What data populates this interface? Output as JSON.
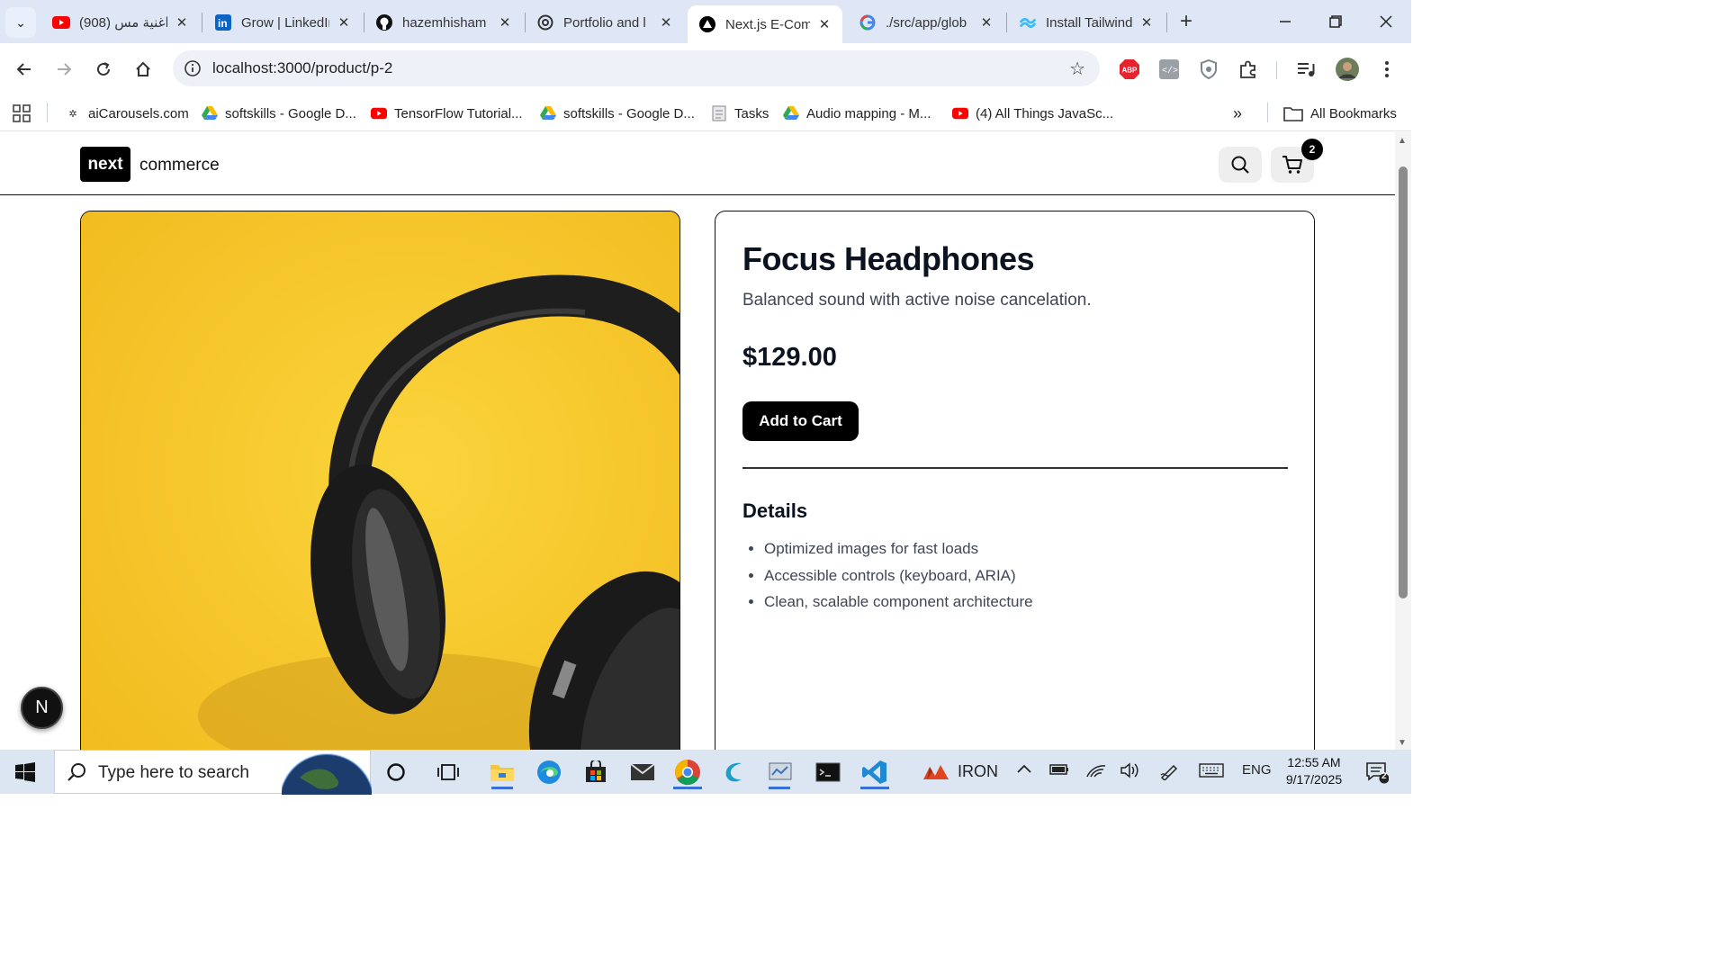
{
  "browser": {
    "tabs": [
      {
        "title": "(908) اغنية مس",
        "icon": "youtube-icon",
        "color": "#ff0000"
      },
      {
        "title": "Grow | LinkedIn",
        "icon": "linkedin-icon",
        "color": "#0a66c2"
      },
      {
        "title": "hazemhisham",
        "icon": "github-icon",
        "color": "#111111"
      },
      {
        "title": "Portfolio and l",
        "icon": "openai-icon",
        "color": "#333333"
      },
      {
        "title": "Next.js E-Com",
        "icon": "nextjs-icon",
        "color": "#000000",
        "active": true
      },
      {
        "title": "./src/app/glob",
        "icon": "google-icon",
        "color": "#4285f4"
      },
      {
        "title": "Install Tailwind",
        "icon": "tailwind-icon",
        "color": "#38bdf8"
      }
    ],
    "url": "localhost:3000/product/p-2",
    "bookmarks": [
      {
        "label": "aiCarousels.com",
        "icon": "aicarousels-icon"
      },
      {
        "label": "softskills - Google D...",
        "icon": "google-drive-icon"
      },
      {
        "label": "TensorFlow Tutorial...",
        "icon": "youtube-icon"
      },
      {
        "label": "softskills - Google D...",
        "icon": "google-drive-icon"
      },
      {
        "label": "Tasks",
        "icon": "document-icon"
      },
      {
        "label": "Audio mapping - M...",
        "icon": "google-drive-icon"
      },
      {
        "label": "(4) All Things JavaSc...",
        "icon": "youtube-icon"
      }
    ],
    "all_bookmarks_label": "All Bookmarks"
  },
  "site": {
    "logo_box": "next",
    "logo_text": "commerce",
    "cart_count": "2"
  },
  "product": {
    "title": "Focus Headphones",
    "subtitle": "Balanced sound with active noise cancelation.",
    "price": "$129.00",
    "add_to_cart_label": "Add to Cart",
    "details_title": "Details",
    "details": [
      "Optimized images for fast loads",
      "Accessible controls (keyboard, ARIA)",
      "Clean, scalable component architecture"
    ],
    "image_background": "#f7c82a"
  },
  "devtools_badge": "N",
  "taskbar": {
    "search_placeholder": "Type here to search",
    "iron_label": "IRON",
    "language": "ENG",
    "time": "12:55 AM",
    "date": "9/17/2025",
    "notification_count": "2"
  }
}
